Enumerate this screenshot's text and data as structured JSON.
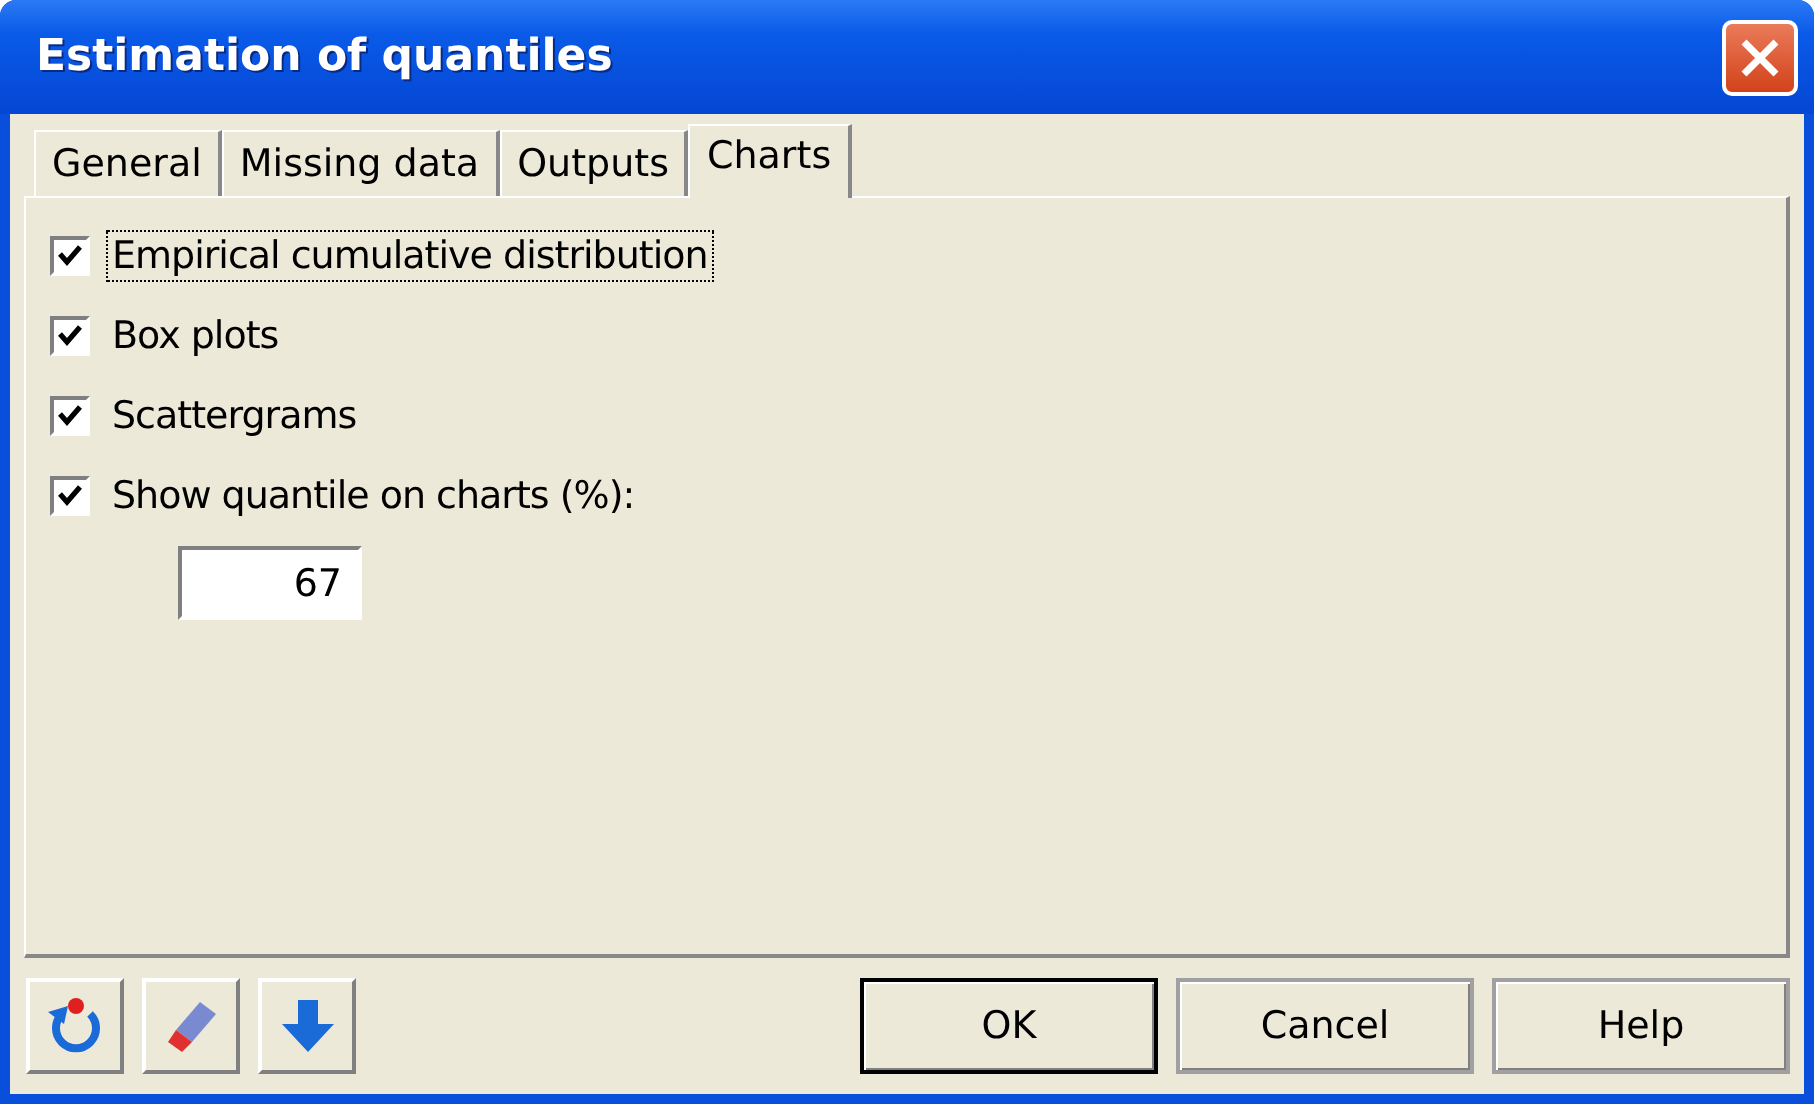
{
  "window": {
    "title": "Estimation of quantiles"
  },
  "tabs": [
    {
      "label": "General",
      "selected": false
    },
    {
      "label": "Missing data",
      "selected": false
    },
    {
      "label": "Outputs",
      "selected": false
    },
    {
      "label": "Charts",
      "selected": true
    }
  ],
  "options": [
    {
      "label": "Empirical cumulative distribution",
      "checked": true,
      "focused": true
    },
    {
      "label": "Box plots",
      "checked": true,
      "focused": false
    },
    {
      "label": "Scattergrams",
      "checked": true,
      "focused": false
    },
    {
      "label": "Show quantile on charts (%):",
      "checked": true,
      "focused": false
    }
  ],
  "quantile_field": {
    "value": "67"
  },
  "buttons": [
    {
      "label": "OK",
      "default": true
    },
    {
      "label": "Cancel",
      "default": false
    },
    {
      "label": "Help",
      "default": false
    }
  ]
}
